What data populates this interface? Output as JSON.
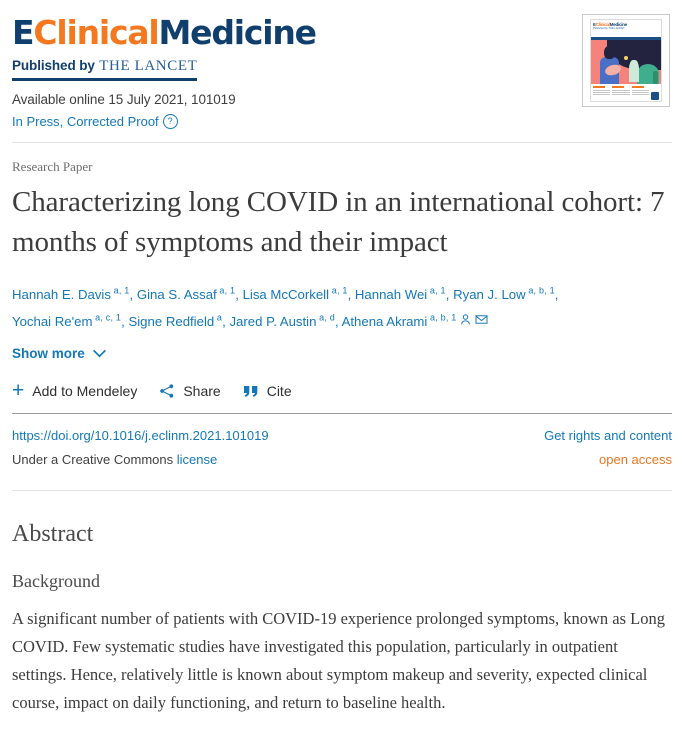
{
  "journal": {
    "logo_e": "E",
    "logo_clinical": "Clinical",
    "logo_medicine": "Medicine",
    "published_by": "Published by",
    "publisher": "THE LANCET",
    "available_online": "Available online 15 July 2021, 101019",
    "status": "In Press, Corrected Proof",
    "status_help_icon": "question-circle-icon",
    "cover_title_e": "E",
    "cover_title_clinical": "Clinical",
    "cover_title_medicine": "Medicine",
    "cover_subtitle": "Published by THE LANCET"
  },
  "article": {
    "kicker": "Research Paper",
    "title": "Characterizing long COVID in an international cohort: 7 months of symptoms and their impact",
    "authors": [
      {
        "name": "Hannah E. Davis",
        "sup": "a, 1",
        "sep": ", "
      },
      {
        "name": "Gina S. Assaf",
        "sup": "a, 1",
        "sep": ", "
      },
      {
        "name": "Lisa McCorkell",
        "sup": "a, 1",
        "sep": ", "
      },
      {
        "name": "Hannah Wei",
        "sup": "a, 1",
        "sep": ", "
      },
      {
        "name": "Ryan J. Low",
        "sup": "a, b, 1",
        "sep": ", "
      },
      {
        "name": "Yochai Re'em",
        "sup": "a, c, 1",
        "sep": ", "
      },
      {
        "name": "Signe Redfield",
        "sup": "a",
        "sep": ", "
      },
      {
        "name": "Jared P. Austin",
        "sup": "a, d",
        "sep": ", "
      },
      {
        "name": "Athena Akrami",
        "sup": "a, b, 1",
        "sep": ""
      }
    ],
    "author_person_icon": "person-icon",
    "author_mail_icon": "envelope-icon",
    "show_more": "Show more",
    "show_more_icon": "chevron-down-icon"
  },
  "actions": [
    {
      "label": "Add to Mendeley",
      "icon": "plus-icon"
    },
    {
      "label": "Share",
      "icon": "share-nodes-icon"
    },
    {
      "label": "Cite",
      "icon": "quote-icon"
    }
  ],
  "doi": {
    "link": "https://doi.org/10.1016/j.eclinm.2021.101019",
    "rights": "Get rights and content",
    "license_prefix": "Under a Creative Commons",
    "license_link": "license",
    "open_access": "open access"
  },
  "abstract": {
    "heading": "Abstract",
    "sections": [
      {
        "heading": "Background",
        "text": "A significant number of patients with COVID-19 experience prolonged symptoms, known as Long COVID. Few systematic studies have investigated this population, particularly in outpatient settings. Hence, relatively little is known about symptom makeup and severity, expected clinical course, impact on daily functioning, and return to baseline health."
      }
    ]
  },
  "colors": {
    "brand_blue": "#103f6d",
    "brand_orange": "#f4781f",
    "link_blue": "#1478b8",
    "open_access_orange": "#e87722",
    "text": "#3c3c3c"
  }
}
